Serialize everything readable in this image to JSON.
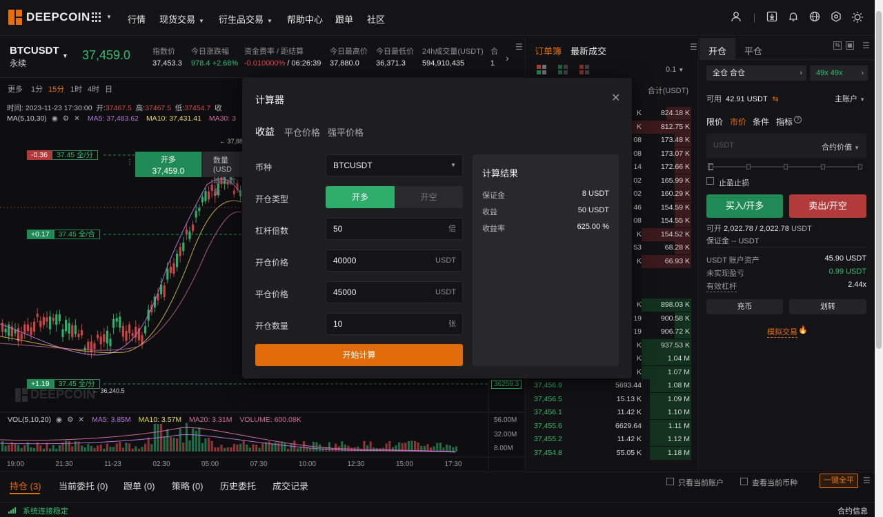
{
  "brand": {
    "name": "DEEPCOIN",
    "watermark": "DEEPCOIN"
  },
  "nav": {
    "items": [
      {
        "label": "行情"
      },
      {
        "label": "现货交易"
      },
      {
        "label": "衍生品交易"
      },
      {
        "label": "帮助中心"
      },
      {
        "label": "跟单"
      },
      {
        "label": "社区"
      }
    ]
  },
  "ticker": {
    "symbol": "BTCUSDT",
    "type": "永续",
    "price": "37,459.0",
    "stats": [
      {
        "label": "指数价",
        "value": "37,453.3",
        "color": "default"
      },
      {
        "label": "今日涨跌幅",
        "value": "978.4 +2.68%",
        "color": "green"
      },
      {
        "label": "资金费率 / 距结算",
        "value": "-0.010000%",
        "extra": " / 06:26:39",
        "color": "red"
      },
      {
        "label": "今日最高价",
        "value": "37,880.0",
        "color": "default"
      },
      {
        "label": "今日最低价",
        "value": "36,371.3",
        "color": "default"
      },
      {
        "label": "24h成交量(USDT)",
        "value": "594,910,435",
        "color": "default"
      },
      {
        "label": "合",
        "value": "1",
        "color": "default"
      }
    ]
  },
  "timeframes": {
    "items": [
      "更多",
      "1分",
      "15分",
      "1时",
      "4时",
      "日"
    ],
    "active": "15分"
  },
  "candle_info": {
    "time_label": "时间:",
    "time": "2023-11-23 17:30:00",
    "open_label": "开:",
    "open": "37467.5",
    "high_label": "高:",
    "high": "37467.5",
    "low_label": "低:",
    "low": "37454.7",
    "close_label": "收"
  },
  "ma": {
    "name": "MA(5,10,30)",
    "ma5": "MA5: 37,483.62",
    "ma10": "MA10: 37,431.41",
    "ma30": "MA30: 3"
  },
  "chart_tags": [
    {
      "left": "-0.36",
      "right": "37.45 全/分"
    },
    {
      "left": "+0.17",
      "right": "37.45 全/合"
    },
    {
      "left": "+1.19",
      "right": "37.45 全/分"
    }
  ],
  "open_long_tag": {
    "title": "开多",
    "price": "37,459.0",
    "qty_label": "数量(USD",
    "placeholder": "输入数量"
  },
  "chart_labels": {
    "high_mark": "37,880",
    "low_mark": "36,240.5",
    "last_price": "36259.3"
  },
  "volume": {
    "name": "VOL(5,10,20)",
    "ma5": "MA5: 3.85M",
    "ma10": "MA10: 3.57M",
    "ma20": "MA20: 3.31M",
    "vol": "VOLUME: 600.08K",
    "axis": [
      "56.00M",
      "32.00M",
      "8.00M"
    ]
  },
  "time_axis": [
    "19:00",
    "21:30",
    "11-23",
    "02:30",
    "05:00",
    "07:30",
    "10:00",
    "12:30",
    "15:00",
    "17:30"
  ],
  "orderbook": {
    "tabs": [
      "订单簿",
      "最新成交"
    ],
    "precision": "0.1",
    "total_header": "合计(USDT)",
    "asks": [
      {
        "q": "K",
        "t": "824.18 K",
        "w": 0.15
      },
      {
        "q": "K",
        "t": "812.75 K",
        "w": 0.5
      },
      {
        "q": "08",
        "t": "173.48 K",
        "w": 0.1
      },
      {
        "q": "08",
        "t": "173.07 K",
        "w": 0.1
      },
      {
        "q": "14",
        "t": "172.66 K",
        "w": 0.1
      },
      {
        "q": "02",
        "t": "165.99 K",
        "w": 0.1
      },
      {
        "q": "02",
        "t": "160.29 K",
        "w": 0.1
      },
      {
        "q": "46",
        "t": "154.59 K",
        "w": 0.1
      },
      {
        "q": "08",
        "t": "154.55 K",
        "w": 0.1
      },
      {
        "q": "K",
        "t": "154.52 K",
        "w": 0.3
      },
      {
        "q": "53",
        "t": "68.28 K",
        "w": 0.1
      },
      {
        "q": "K",
        "t": "66.93 K",
        "w": 0.3
      }
    ],
    "bids_top": [
      {
        "q": "K",
        "t": "898.03 K",
        "w": 0.3
      },
      {
        "q": "19",
        "t": "900.58 K",
        "w": 0.1
      },
      {
        "q": "19",
        "t": "906.72 K",
        "w": 0.1
      },
      {
        "q": "K",
        "t": "937.53 K",
        "w": 0.3
      },
      {
        "q": "K",
        "t": "1.04 M",
        "w": 0.3
      },
      {
        "q": "K",
        "t": "1.07 M",
        "w": 0.3
      }
    ],
    "bids": [
      {
        "p": "37,456.9",
        "q": "5693.44",
        "t": "1.08 M"
      },
      {
        "p": "37,456.5",
        "q": "15.13 K",
        "t": "1.09 M"
      },
      {
        "p": "37,456.1",
        "q": "11.42 K",
        "t": "1.10 M"
      },
      {
        "p": "37,455.6",
        "q": "6629.64",
        "t": "1.11 M"
      },
      {
        "p": "37,455.2",
        "q": "11.42 K",
        "t": "1.12 M"
      },
      {
        "p": "37,454.8",
        "q": "55.05 K",
        "t": "1.18 M"
      }
    ]
  },
  "trade": {
    "tabs": [
      "开仓",
      "平仓"
    ],
    "margin_mode": "全仓 合仓",
    "leverage": "49x 49x",
    "avail_label": "可用",
    "avail": "42.91",
    "avail_unit": "USDT",
    "account": "主账户",
    "order_types": [
      "限价",
      "市价",
      "条件",
      "指标"
    ],
    "amount_placeholder": "USDT",
    "amount_unit": "合约价值",
    "tpsl": "止盈止损",
    "buy": "买入/开多",
    "sell": "卖出/开空",
    "can_open_label": "可开",
    "can_open": "2,022.78 / 2,022.78",
    "can_open_unit": "USDT",
    "margin_label": "保证金",
    "margin_value": "-- USDT",
    "assets": [
      {
        "k": "USDT 账户资产",
        "v": "45.90 USDT"
      },
      {
        "k": "未实现盈亏",
        "v": "0.99 USDT"
      },
      {
        "k": "有效杠杆",
        "v": "2.44x"
      }
    ],
    "deposit": "充币",
    "transfer": "划转",
    "demo": "模拟交易"
  },
  "bottom": {
    "tabs": [
      "持仓 (3)",
      "当前委托 (0)",
      "跟单 (0)",
      "策略 (0)",
      "历史委托",
      "成交记录"
    ],
    "only_current": "只看当前账户",
    "current_coin": "查看当前币种",
    "close_all": "一键全平",
    "status": "系统连接稳定",
    "contract_info": "合约信息"
  },
  "calculator": {
    "title": "计算器",
    "tabs": [
      "收益",
      "平仓价格",
      "强平价格"
    ],
    "coin_label": "币种",
    "coin": "BTCUSDT",
    "type_label": "开仓类型",
    "long": "开多",
    "short": "开空",
    "lev_label": "杠杆倍数",
    "lev": "50",
    "lev_unit": "倍",
    "open_label": "开仓价格",
    "open": "40000",
    "open_unit": "USDT",
    "close_label": "平仓价格",
    "close": "45000",
    "close_unit": "USDT",
    "qty_label": "开仓数量",
    "qty": "10",
    "qty_unit": "张",
    "calc_button": "开始计算",
    "result": {
      "title": "计算结果",
      "rows": [
        {
          "k": "保证金",
          "v": "8 USDT"
        },
        {
          "k": "收益",
          "v": "50 USDT"
        },
        {
          "k": "收益率",
          "v": "625.00 %"
        }
      ]
    }
  }
}
